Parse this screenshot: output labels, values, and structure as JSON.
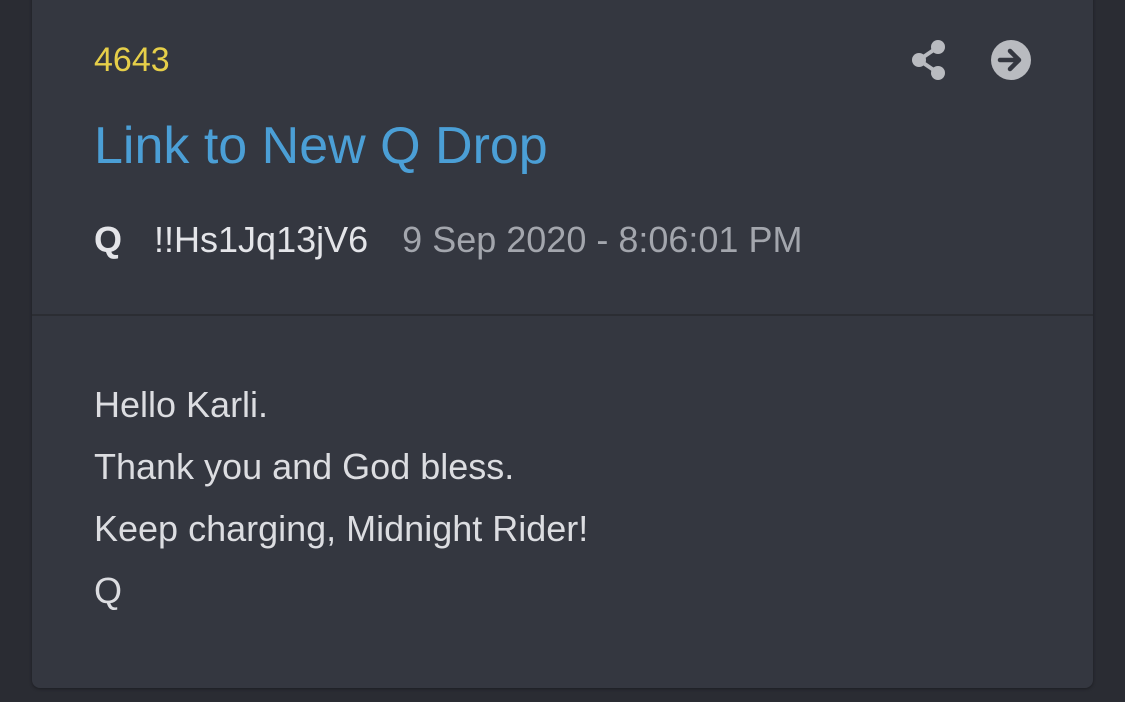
{
  "post": {
    "number": "4643",
    "title": "Link to New Q Drop",
    "author": "Q",
    "tripcode": "!!Hs1Jq13jV6",
    "timestamp": "9 Sep 2020 - 8:06:01 PM",
    "body_lines": [
      "Hello Karli.",
      "Thank you and God bless.",
      "Keep charging, Midnight Rider!",
      "Q"
    ]
  },
  "actions": {
    "share_icon": "share-icon",
    "open_icon": "arrow-right-circle-icon"
  },
  "colors": {
    "background": "#2a2c33",
    "card": "#343740",
    "post_number": "#e6cf49",
    "title_link": "#4b9fd6",
    "meta_date": "#a3a6ad",
    "text": "#dcdde1",
    "icon": "#b9bbc0"
  }
}
